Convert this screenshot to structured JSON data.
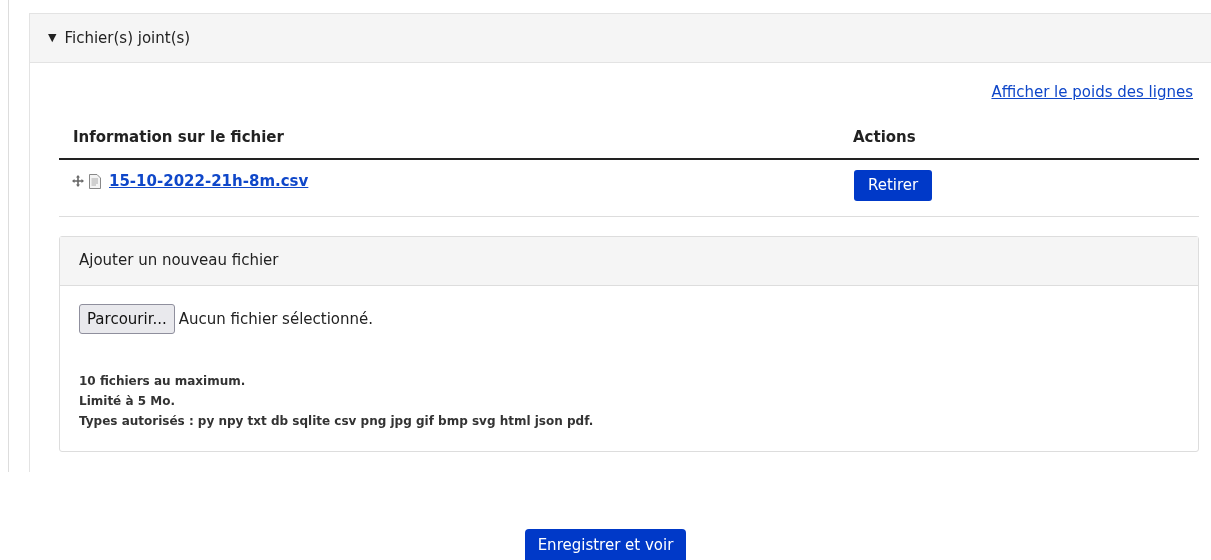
{
  "panel": {
    "toggle": "▼",
    "title": "Fichier(s) joint(s)",
    "expanded": true
  },
  "weights_link": "Afficher le poids des lignes",
  "table": {
    "columns": [
      "Information sur le fichier",
      "Actions"
    ],
    "rows": [
      {
        "file": "15-10-2022-21h-8m.csv",
        "action": "Retirer"
      }
    ]
  },
  "add_file": {
    "title": "Ajouter un nouveau fichier",
    "browse_button": "Parcourir...",
    "status": "Aucun fichier sélectionné.",
    "notes": [
      "10 fichiers au maximum.",
      "Limité à 5 Mo.",
      "Types autorisés : py npy txt db sqlite csv png jpg gif bmp svg html json pdf."
    ]
  },
  "submit": "Enregistrer et voir"
}
